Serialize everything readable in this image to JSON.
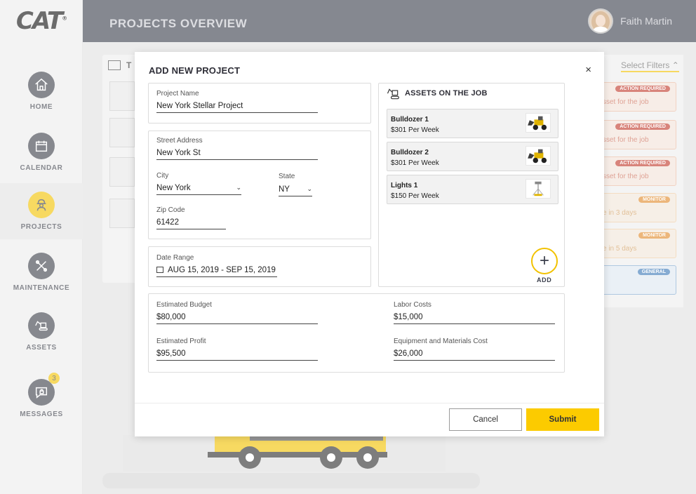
{
  "brand": {
    "logo_text": "CAT",
    "logo_mark": "®"
  },
  "header": {
    "title": "PROJECTS OVERVIEW",
    "user_name": "Faith Martin"
  },
  "sidebar": {
    "items": [
      {
        "label": "HOME",
        "icon": "home-icon"
      },
      {
        "label": "CALENDAR",
        "icon": "calendar-icon"
      },
      {
        "label": "PROJECTS",
        "icon": "worker-icon",
        "active": true
      },
      {
        "label": "MAINTENANCE",
        "icon": "tools-icon"
      },
      {
        "label": "ASSETS",
        "icon": "excavator-icon"
      },
      {
        "label": "MESSAGES",
        "icon": "chat-lock-icon",
        "badge": "3"
      }
    ]
  },
  "background": {
    "card_heading_partial": "T",
    "filters_label": "Select Filters",
    "alerts": [
      {
        "pill": "ACTION REQUIRED",
        "text": "sset for the job",
        "kind": "action"
      },
      {
        "pill": "ACTION REQUIRED",
        "text": "sset for the job",
        "kind": "action"
      },
      {
        "pill": "ACTION REQUIRED",
        "text": "sset for the job",
        "kind": "action"
      },
      {
        "pill": "MONITOR",
        "text": "e in 3 days",
        "kind": "monitor"
      },
      {
        "pill": "MONITOR",
        "text": "e in 5 days",
        "kind": "monitor"
      },
      {
        "pill": "GENERAL",
        "text": "",
        "kind": "general"
      }
    ]
  },
  "modal": {
    "title": "ADD NEW PROJECT",
    "close": "×",
    "project_name": {
      "label": "Project Name",
      "value": "New York Stellar Project"
    },
    "street": {
      "label": "Street Address",
      "value": "New York St"
    },
    "city": {
      "label": "City",
      "value": "New York"
    },
    "state": {
      "label": "State",
      "value": "NY"
    },
    "zip": {
      "label": "Zip Code",
      "value": "61422"
    },
    "date_range": {
      "label": "Date Range",
      "value": "AUG 15, 2019 - SEP 15, 2019"
    },
    "assets": {
      "title": "ASSETS ON THE JOB",
      "items": [
        {
          "name": "Bulldozer 1",
          "price": "$301 Per Week",
          "thumb": "backhoe-loader-icon"
        },
        {
          "name": "Bulldozer 2",
          "price": "$301 Per Week",
          "thumb": "backhoe-loader-icon"
        },
        {
          "name": "Lights 1",
          "price": "$150 Per Week",
          "thumb": "light-tower-icon"
        }
      ],
      "add_label": "ADD"
    },
    "budget": {
      "label": "Estimated Budget",
      "value": "$80,000"
    },
    "labor": {
      "label": "Labor Costs",
      "value": "$15,000"
    },
    "profit": {
      "label": "Estimated Profit",
      "value": "$95,500"
    },
    "equipment": {
      "label": "Equipment and Materials Cost",
      "value": "$26,000"
    },
    "cancel_label": "Cancel",
    "submit_label": "Submit"
  },
  "colors": {
    "accent": "#fccb00",
    "header_bg": "#3b3f4c",
    "danger": "#c0392b",
    "warning": "#e08a2b",
    "info": "#3a78b7"
  }
}
